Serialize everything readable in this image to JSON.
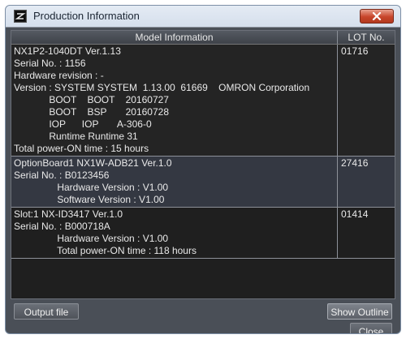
{
  "window": {
    "title": "Production Information",
    "close_icon": "close-icon",
    "app_icon": "app-icon"
  },
  "table": {
    "headers": {
      "model": "Model Information",
      "lot": "LOT No."
    },
    "rows": [
      {
        "lines": [
          "NX1P2-1040DT Ver.1.13",
          "Serial No. : 1156",
          "Hardware revision : -",
          "Version : SYSTEM SYSTEM  1.13.00  61669    OMRON Corporation",
          "             BOOT    BOOT    20160727",
          "             BOOT    BSP       20160728",
          "             IOP      IOP       A-306-0",
          "             Runtime Runtime 31",
          "Total power-ON time : 15 hours"
        ],
        "lot": "01716"
      },
      {
        "lines": [
          "OptionBoard1 NX1W-ADB21 Ver.1.0",
          "Serial No. : B0123456",
          "                Hardware Version : V1.00",
          "                Software Version : V1.00"
        ],
        "lot": "27416"
      },
      {
        "lines": [
          "Slot:1 NX-ID3417 Ver.1.0",
          "Serial No. : B000718A",
          "                Hardware Version : V1.00",
          "                Total power-ON time : 118 hours"
        ],
        "lot": "01414"
      }
    ]
  },
  "buttons": {
    "output_file": "Output file",
    "show_outline": "Show Outline",
    "close": "Close"
  }
}
